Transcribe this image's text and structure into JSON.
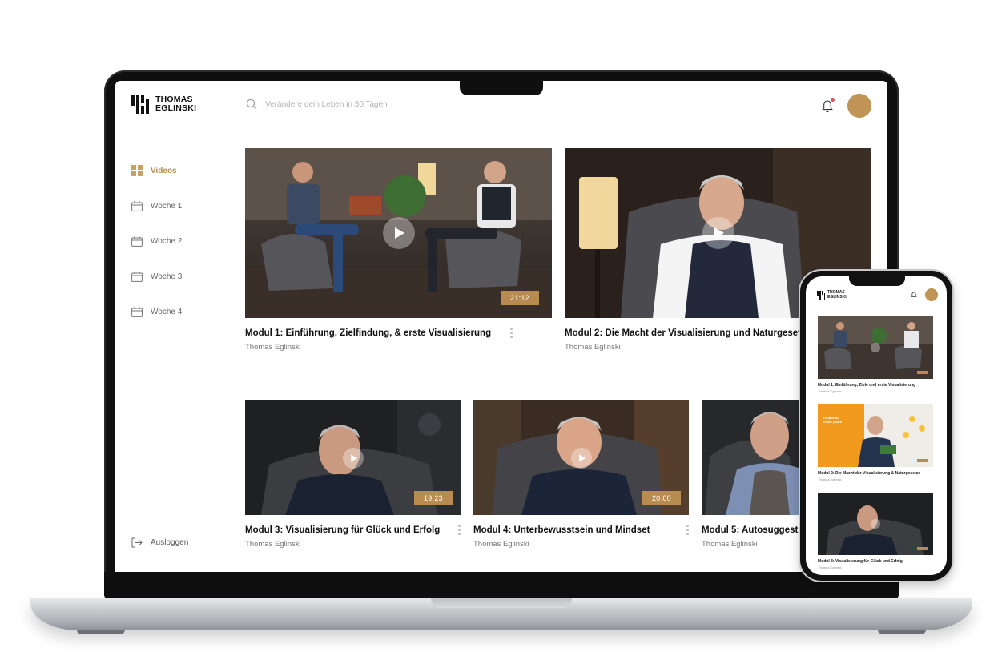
{
  "app": {
    "logo_text": "THOMAS\nEGLINSKI",
    "search_placeholder": "Verändere dein Leben in 30 Tagen"
  },
  "sidebar": {
    "items": [
      {
        "label": "Videos",
        "icon": "grid-icon",
        "active": true
      },
      {
        "label": "Woche 1",
        "icon": "calendar-icon",
        "active": false
      },
      {
        "label": "Woche 2",
        "icon": "calendar-icon",
        "active": false
      },
      {
        "label": "Woche 3",
        "icon": "calendar-icon",
        "active": false
      },
      {
        "label": "Woche 4",
        "icon": "calendar-icon",
        "active": false
      }
    ],
    "logout_label": "Ausloggen"
  },
  "videos": [
    {
      "title": "Modul 1: Einführung, Zielfindung, & erste Visualisierung",
      "author": "Thomas Eglinski",
      "duration": "21:12"
    },
    {
      "title": "Modul 2: Die Macht der Visualisierung und Naturgesetze",
      "author": "Thomas Eglinski",
      "duration": ""
    },
    {
      "title": "Modul 3: Visualisierung für Glück und Erfolg",
      "author": "Thomas Eglinski",
      "duration": "19:23"
    },
    {
      "title": "Modul 4: Unterbewusstsein und Mindset",
      "author": "Thomas Eglinski",
      "duration": "20:00"
    },
    {
      "title": "Modul 5: Autosuggestion",
      "author": "Thomas Eglinski",
      "duration": ""
    }
  ],
  "mobile": {
    "logo_text": "THOMAS\nEGLINSKI",
    "videos": [
      {
        "title": "Modul 1: Einführung, Ziele und erste Visualisierung",
        "author": "Thomas Eglinski"
      },
      {
        "title": "Modul 2: Die Macht der Visualisierung & Naturgesetze",
        "author": "Thomas Eglinski",
        "banner_text": "It's time to define yours"
      },
      {
        "title": "Modul 3: Visualisierung für Glück und Erfolg",
        "author": "Thomas Eglinski"
      }
    ]
  },
  "colors": {
    "accent": "#b88c50",
    "avatar": "#bf9455",
    "notification": "#e74c4c",
    "laptop_bezel": "#0f0f10"
  }
}
